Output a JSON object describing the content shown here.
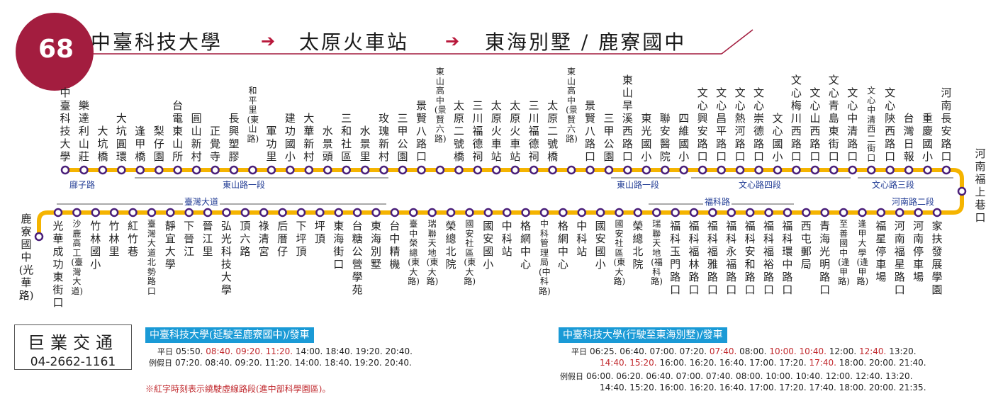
{
  "route": {
    "number": "68",
    "origin": "中臺科技大學",
    "middle": "太原火車站",
    "destination": "東海別墅 / 鹿寮國中"
  },
  "colors": {
    "badge": "#a31d3f",
    "route_line": "#f5b400",
    "stop_outline": "#4a1f7a",
    "road_label": "#1f3a93",
    "header": "#1a9ad6",
    "red_time": "#c0282d"
  },
  "top_stops": [
    "中臺科技大學",
    "樂達利山莊",
    "大坑橋",
    "大坑圓環",
    "逢甲橋",
    "梨仔園",
    "台電東山所",
    "圓山新村",
    "正覺寺",
    "長興塑膠",
    "和平里(東山路)",
    "軍功里",
    "建功國小",
    "大華新村",
    "水景頭",
    "三和社區",
    "水景里",
    "玫瑰新村",
    "三甲公園",
    "景賢八路口",
    "東山高中(景賢六路)",
    "太原二號橋",
    "三川福德祠",
    "太原火車站",
    "太原火車站",
    "三川福德祠",
    "太原二號橋",
    "東山高中(景賢六路)",
    "景賢八路口",
    "三甲公園",
    "東山旱溪西路口",
    "東光國小",
    "聯安醫院",
    "四維國小",
    "文心興安路口",
    "文心昌平路口",
    "文心熱河路口",
    "文心崇德路口",
    "文心國小",
    "文心梅川西路口",
    "文心山西路口",
    "文心青島東街口",
    "文心中清路口",
    "文心中清西二街口",
    "文心陝西路口",
    "台灣日報",
    "重慶國小",
    "河南長安路口"
  ],
  "bottom_stops": [
    "光華成功東街口",
    "沙鹿高工(臺灣大道)",
    "竹林國小",
    "竹林里",
    "紅竹巷",
    "臺灣大道北勢路口",
    "靜宜大學",
    "下晉江",
    "晉江里",
    "弘光科技大學",
    "頂六路",
    "祿清宮",
    "后厝仔",
    "下坪頂",
    "坪頂",
    "東海街口",
    "台糖公營學苑",
    "東海別墅",
    "台中精機",
    "臺中榮總(東大路)",
    "瑞聯天地(東大路)",
    "榮總北院",
    "國安社區(東大路)",
    "國安國小",
    "中科站",
    "格網中心",
    "中科管理局(中科路)",
    "格網中心",
    "中科站",
    "國安國小",
    "國安社區(東大路)",
    "榮總北院",
    "瑞聯天地(福科路)",
    "福科玉門路口",
    "福科福林路口",
    "福科福雅路口",
    "福科永福路口",
    "福科安和路口",
    "福科福裕路口",
    "福科環中路口",
    "西屯郵局",
    "青海光明路口",
    "至善國中(逢甲路)",
    "逢甲大學(逢甲路)",
    "福星停車場",
    "河南福星路口",
    "河南停車場",
    "家扶發展學園"
  ],
  "end_stops": {
    "right": "河南福上巷口",
    "left": "鹿寮國中(光華路)"
  },
  "roads": {
    "top": [
      "廍子路",
      "東山路一段",
      "東山路一段",
      "文心路四段",
      "文心路三段"
    ],
    "bottom": [
      "臺灣大道",
      "福科路",
      "河南路二段"
    ]
  },
  "company": {
    "name": "巨業交通",
    "phone": "04-2662-1161"
  },
  "schedule_left": {
    "header": "中臺科技大學(延駛至鹿寮國中)/發車",
    "weekday_label": "平日",
    "weekday_times": [
      {
        "t": "05:50.",
        "red": false
      },
      {
        "t": "08:40.",
        "red": true
      },
      {
        "t": "09:20.",
        "red": true
      },
      {
        "t": "11:20.",
        "red": true
      },
      {
        "t": "14:00.",
        "red": false
      },
      {
        "t": "18:40.",
        "red": false
      },
      {
        "t": "19:20.",
        "red": false
      },
      {
        "t": "20:40.",
        "red": false
      }
    ],
    "holiday_label": "例假日",
    "holiday_times": "07:20. 08:40. 09:20. 11:20. 14:00. 18:40. 19:20. 20:40."
  },
  "schedule_right": {
    "header": "中臺科技大學(行駛至東海別墅)/發車",
    "weekday_label": "平日",
    "weekday_line1": [
      {
        "t": "06:25.",
        "red": false
      },
      {
        "t": "06:40.",
        "red": false
      },
      {
        "t": "07:00.",
        "red": false
      },
      {
        "t": "07:20.",
        "red": false
      },
      {
        "t": "07:40.",
        "red": true
      },
      {
        "t": "08:00.",
        "red": false
      },
      {
        "t": "10:00.",
        "red": true
      },
      {
        "t": "10:40.",
        "red": true
      },
      {
        "t": "12:00.",
        "red": false
      },
      {
        "t": "12:40.",
        "red": true
      },
      {
        "t": "13:20.",
        "red": false
      }
    ],
    "weekday_line2": [
      {
        "t": "14:40.",
        "red": true
      },
      {
        "t": "15:20.",
        "red": true
      },
      {
        "t": "16:00.",
        "red": false
      },
      {
        "t": "16:20.",
        "red": false
      },
      {
        "t": "16:40.",
        "red": false
      },
      {
        "t": "17:00.",
        "red": false
      },
      {
        "t": "17:20.",
        "red": false
      },
      {
        "t": "17:40.",
        "red": true
      },
      {
        "t": "18:00.",
        "red": false
      },
      {
        "t": "20:00.",
        "red": false
      },
      {
        "t": "21:40.",
        "red": false
      }
    ],
    "holiday_label": "例假日",
    "holiday_line1": "06:00. 06:20. 06:40. 07:00. 07:40. 08:00. 10:00. 10:40. 12:00. 12:40. 13:20.",
    "holiday_line2": "14:40. 15:20. 16:00. 16:20. 16:40. 17:00. 17:20. 17:40. 18:00. 20:00. 21:35."
  },
  "note": "※紅字時刻表示繞駛虛線路段(進中部科學園區)。"
}
